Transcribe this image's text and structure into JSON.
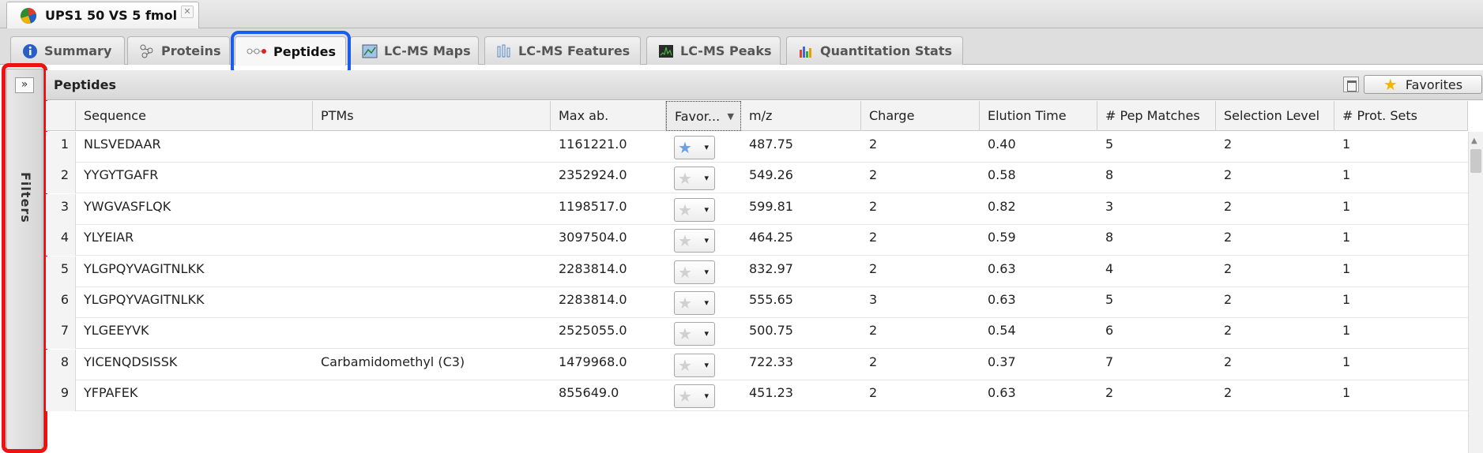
{
  "document_tab": {
    "title": "UPS1 50 VS 5 fmol",
    "close": "✕"
  },
  "view_tabs": [
    {
      "label": "Summary",
      "icon": "info-icon"
    },
    {
      "label": "Proteins",
      "icon": "proteins-icon"
    },
    {
      "label": "Peptides",
      "icon": "peptides-icon",
      "active": true
    },
    {
      "label": "LC-MS Maps",
      "icon": "maps-icon"
    },
    {
      "label": "LC-MS Features",
      "icon": "features-icon"
    },
    {
      "label": "LC-MS Peaks",
      "icon": "peaks-icon"
    },
    {
      "label": "Quantitation Stats",
      "icon": "stats-icon"
    }
  ],
  "filters_panel": {
    "label": "Filters",
    "expand": "»"
  },
  "panel": {
    "title": "Peptides",
    "favorites_label": "Favorites"
  },
  "columns": [
    "Sequence",
    "PTMs",
    "Max ab.",
    "Favor...",
    "m/z",
    "Charge",
    "Elution Time",
    "# Pep Matches",
    "Selection Level",
    "# Prot. Sets"
  ],
  "rows": [
    {
      "n": "1",
      "sequence": "NLSVEDAAR",
      "ptms": "",
      "max_ab": "1161221.0",
      "fav": true,
      "mz": "487.75",
      "charge": "2",
      "elution": "0.40",
      "pep_matches": "5",
      "selection": "2",
      "prot_sets": "1"
    },
    {
      "n": "2",
      "sequence": "YYGYTGAFR",
      "ptms": "",
      "max_ab": "2352924.0",
      "fav": false,
      "mz": "549.26",
      "charge": "2",
      "elution": "0.58",
      "pep_matches": "8",
      "selection": "2",
      "prot_sets": "1"
    },
    {
      "n": "3",
      "sequence": "YWGVASFLQK",
      "ptms": "",
      "max_ab": "1198517.0",
      "fav": false,
      "mz": "599.81",
      "charge": "2",
      "elution": "0.82",
      "pep_matches": "3",
      "selection": "2",
      "prot_sets": "1"
    },
    {
      "n": "4",
      "sequence": "YLYEIAR",
      "ptms": "",
      "max_ab": "3097504.0",
      "fav": false,
      "mz": "464.25",
      "charge": "2",
      "elution": "0.59",
      "pep_matches": "8",
      "selection": "2",
      "prot_sets": "1"
    },
    {
      "n": "5",
      "sequence": "YLGPQYVAGITNLKK",
      "ptms": "",
      "max_ab": "2283814.0",
      "fav": false,
      "mz": "832.97",
      "charge": "2",
      "elution": "0.63",
      "pep_matches": "4",
      "selection": "2",
      "prot_sets": "1"
    },
    {
      "n": "6",
      "sequence": "YLGPQYVAGITNLKK",
      "ptms": "",
      "max_ab": "2283814.0",
      "fav": false,
      "mz": "555.65",
      "charge": "3",
      "elution": "0.63",
      "pep_matches": "5",
      "selection": "2",
      "prot_sets": "1"
    },
    {
      "n": "7",
      "sequence": "YLGEEYVK",
      "ptms": "",
      "max_ab": "2525055.0",
      "fav": false,
      "mz": "500.75",
      "charge": "2",
      "elution": "0.54",
      "pep_matches": "6",
      "selection": "2",
      "prot_sets": "1"
    },
    {
      "n": "8",
      "sequence": "YICENQDSISSK",
      "ptms": "Carbamidomethyl (C3)",
      "max_ab": "1479968.0",
      "fav": false,
      "mz": "722.33",
      "charge": "2",
      "elution": "0.37",
      "pep_matches": "7",
      "selection": "2",
      "prot_sets": "1"
    },
    {
      "n": "9",
      "sequence": "YFPAFEK",
      "ptms": "",
      "max_ab": "855649.0",
      "fav": false,
      "mz": "451.23",
      "charge": "2",
      "elution": "0.63",
      "pep_matches": "2",
      "selection": "2",
      "prot_sets": "1"
    }
  ],
  "colors": {
    "highlight_blue": "#1a5cf0",
    "highlight_red": "#ee1212",
    "star_on": "#6d9fe4",
    "star_gold": "#f2b600"
  }
}
